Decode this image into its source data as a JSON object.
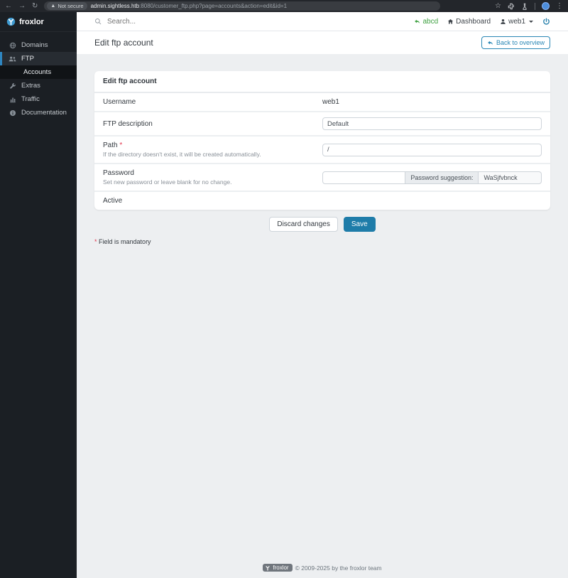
{
  "browser": {
    "not_secure": "Not secure",
    "url_host": "admin.sightless.htb",
    "url_rest": ":8080/customer_ftp.php?page=accounts&action=edit&id=1"
  },
  "sidebar": {
    "brand": "froxlor",
    "items": [
      {
        "label": "Domains",
        "icon": "globe-icon"
      },
      {
        "label": "FTP",
        "icon": "users-icon",
        "active": true
      },
      {
        "label": "Accounts",
        "sub": true,
        "active": true
      },
      {
        "label": "Extras",
        "icon": "wrench-icon"
      },
      {
        "label": "Traffic",
        "icon": "bar-chart-icon"
      },
      {
        "label": "Documentation",
        "icon": "info-icon"
      }
    ]
  },
  "topbar": {
    "search_placeholder": "Search...",
    "customer_link": "abcd",
    "dashboard_link": "Dashboard",
    "user_menu": "web1"
  },
  "page": {
    "title": "Edit ftp account",
    "back_button": "Back to overview"
  },
  "card": {
    "title": "Edit ftp account",
    "username": {
      "label": "Username",
      "value": "web1"
    },
    "description": {
      "label": "FTP description",
      "value": "Default"
    },
    "path": {
      "label": "Path",
      "required_mark": "*",
      "hint": "If the directory doesn't exist, it will be created automatically.",
      "value": "/"
    },
    "password": {
      "label": "Password",
      "hint": "Set new password or leave blank for no change.",
      "value": "",
      "suggestion_label": "Password suggestion:",
      "suggestion_value": "WaSjfvbnck"
    },
    "active": {
      "label": "Active",
      "enabled": true
    }
  },
  "actions": {
    "discard": "Discard changes",
    "save": "Save"
  },
  "notes": {
    "mandatory_mark": "*",
    "mandatory": "Field is mandatory"
  },
  "footer": {
    "brand": "froxlor",
    "copyright": "© 2009-2025 by the froxlor team"
  },
  "colors": {
    "primary": "#1e7ca9",
    "link_green": "#3fa142",
    "sidebar_bg": "#1b1f24",
    "danger": "#e2354d"
  }
}
